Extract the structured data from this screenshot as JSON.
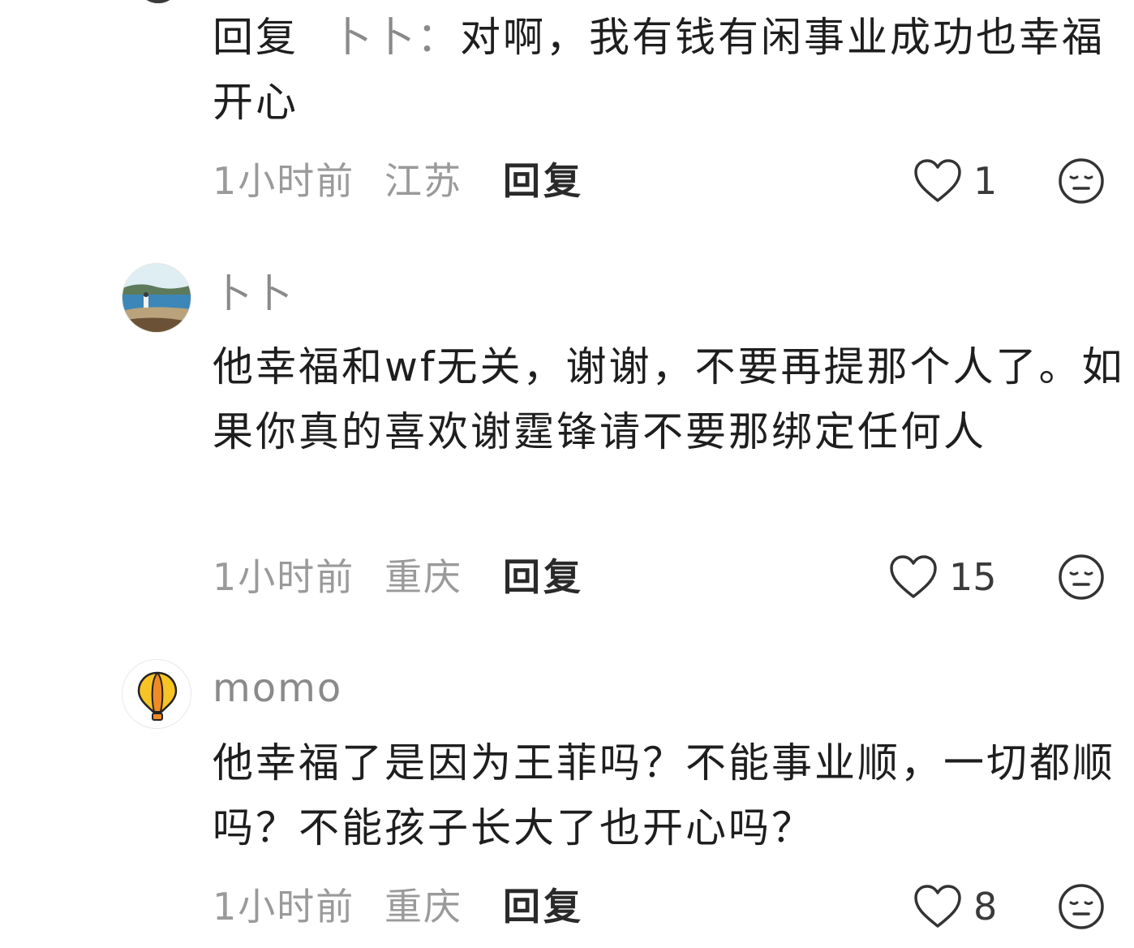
{
  "comments": [
    {
      "reply_prefix": "回复",
      "reply_target": "卜卜：",
      "text": "对啊，我有钱有闲事业成功也幸福开心",
      "time": "1小时前",
      "location": "江苏",
      "reply_label": "回复",
      "likes": "1"
    },
    {
      "username": "卜卜",
      "text": "他幸福和wf无关，谢谢，不要再提那个人了。如果你真的喜欢谢霆锋请不要那绑定任何人",
      "time": "1小时前",
      "location": "重庆",
      "reply_label": "回复",
      "likes": "15"
    },
    {
      "username": "momo",
      "text": "他幸福了是因为王菲吗？不能事业顺，一切都顺吗？不能孩子长大了也开心吗？",
      "time": "1小时前",
      "location": "重庆",
      "reply_label": "回复",
      "likes": "8"
    }
  ],
  "icons": {
    "like": "heart-outline-icon",
    "dislike": "meh-face-icon"
  },
  "colors": {
    "text_primary": "#1e1e1e",
    "text_secondary": "#9a9a9a",
    "icon_stroke": "#333333",
    "balloon_yellow": "#f7c325",
    "balloon_orange": "#f08a24"
  }
}
